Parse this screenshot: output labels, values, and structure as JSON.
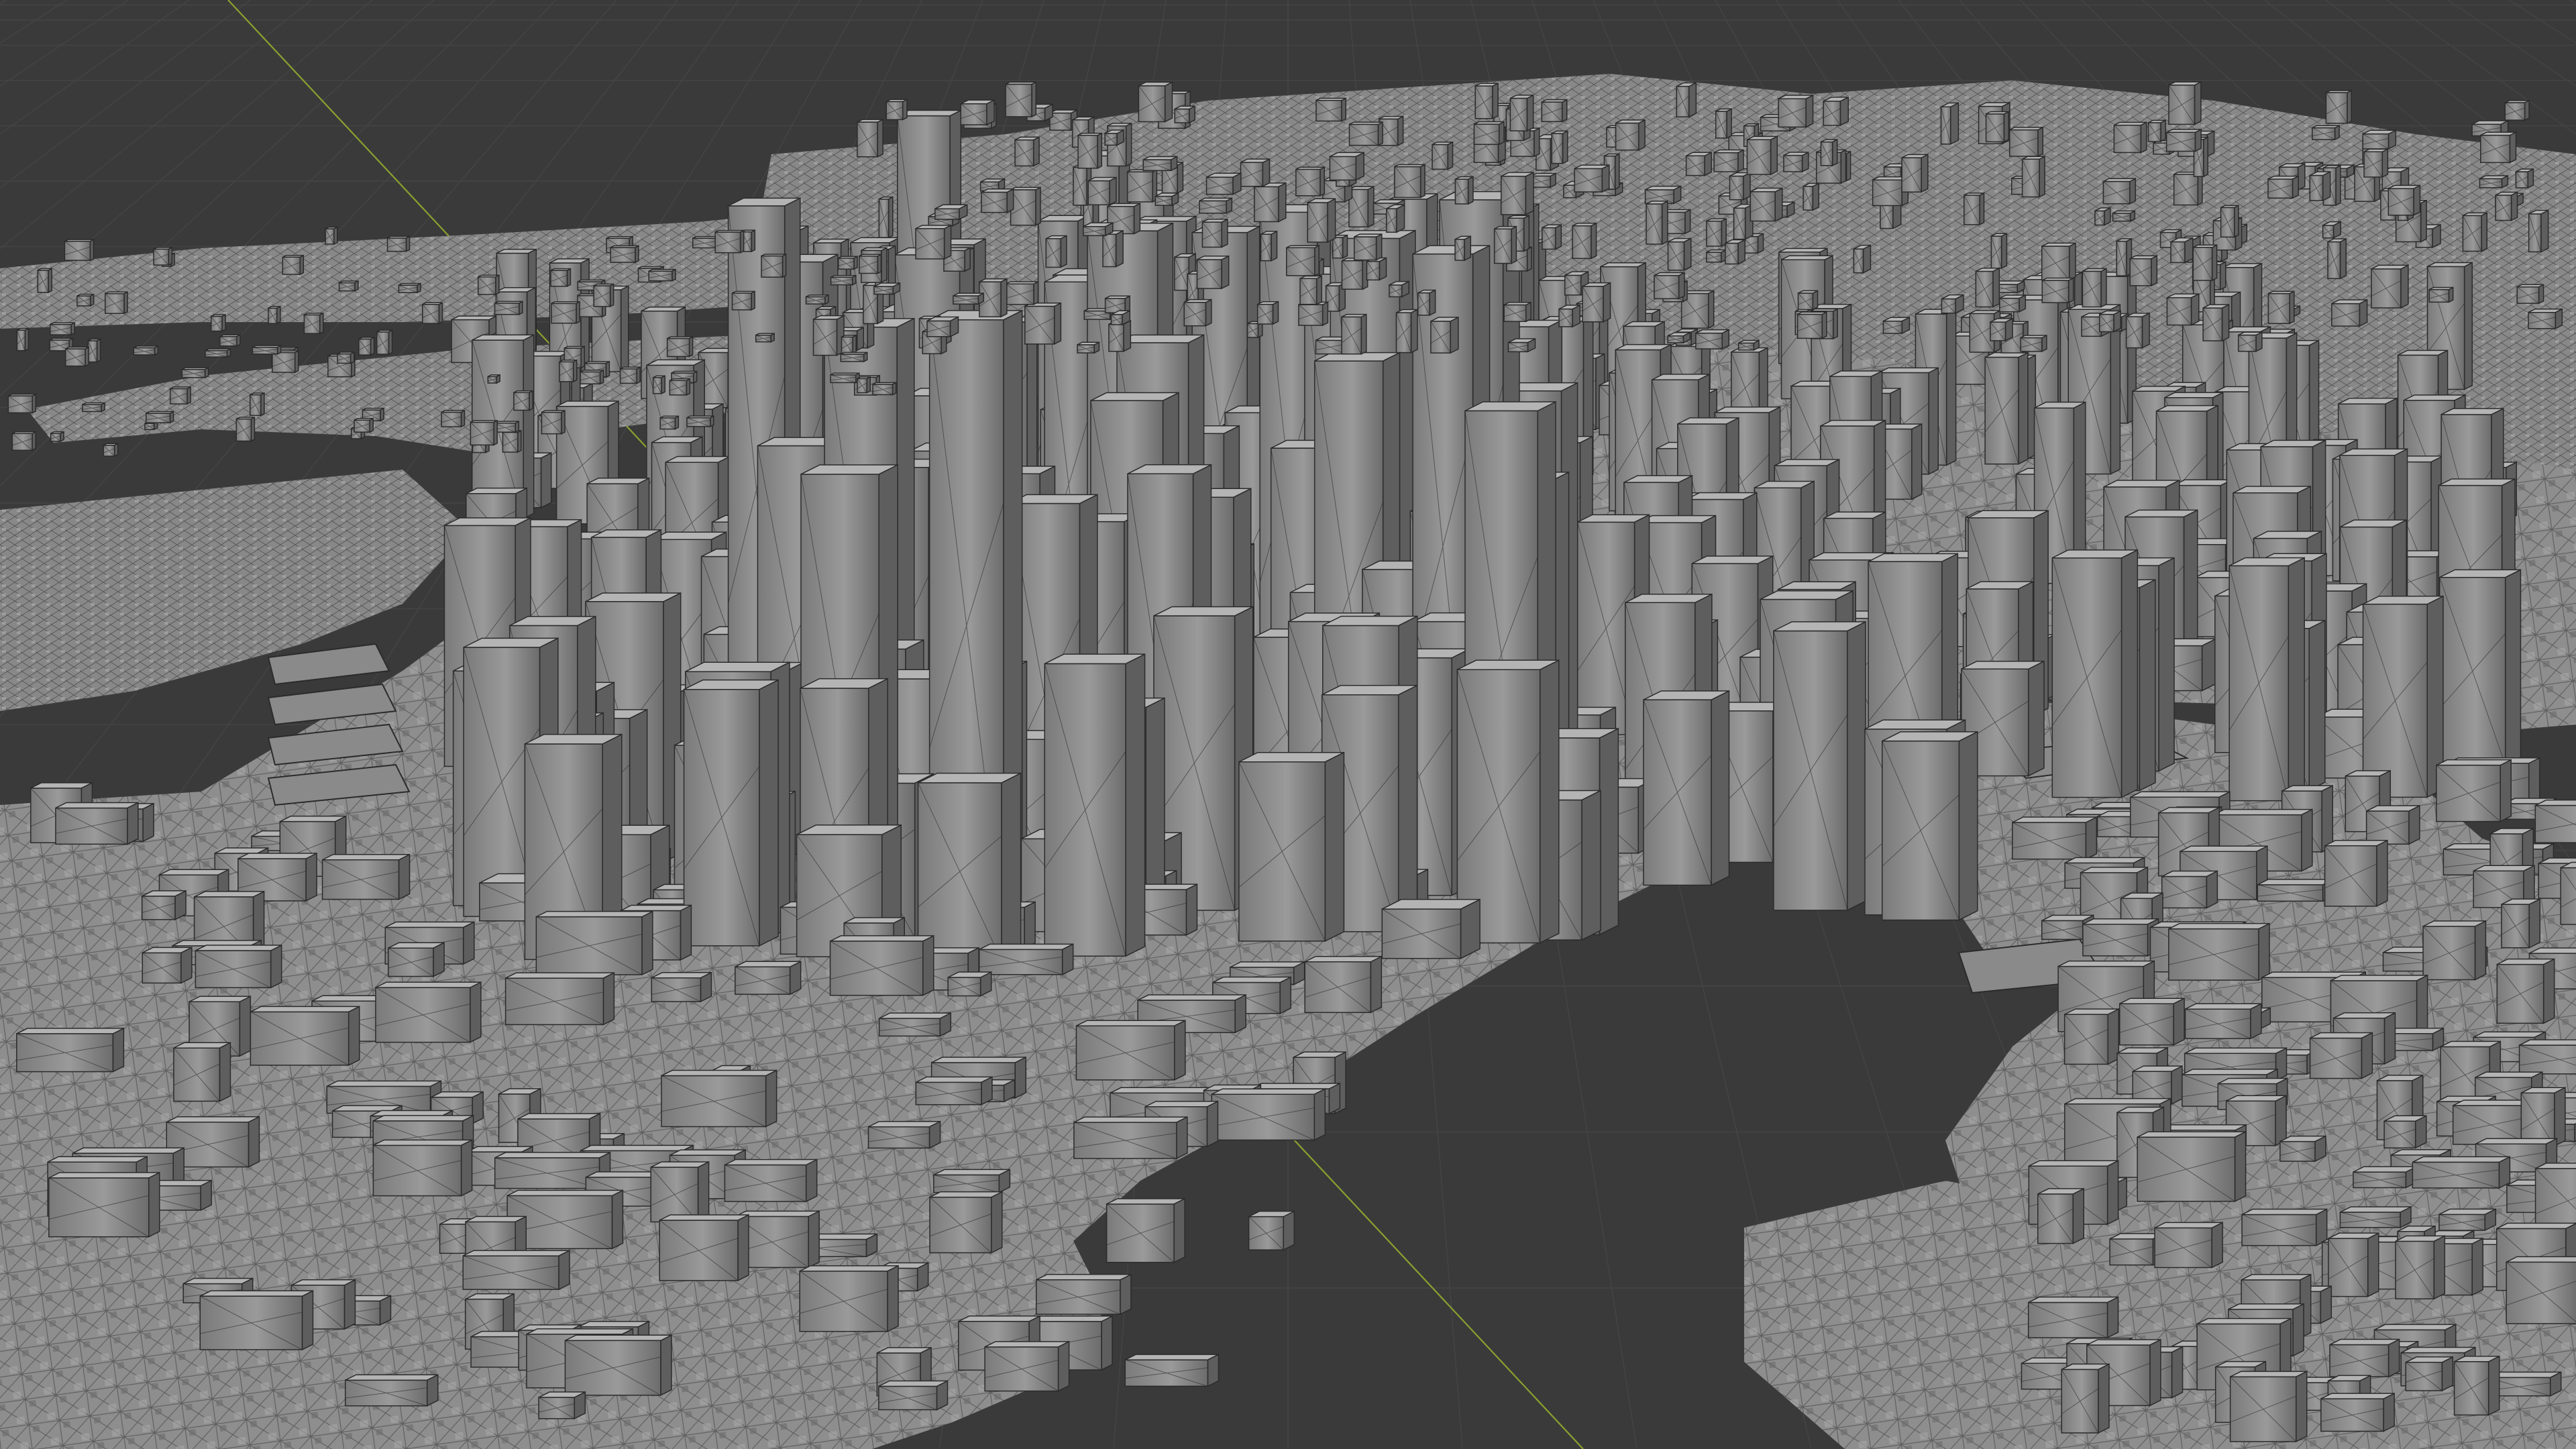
{
  "viewport": {
    "background_color": "#3a3a3a",
    "grid_color": "#444444",
    "y_axis_color": "#8aa12f",
    "mesh_fill_color": "#8c8c8c",
    "mesh_shadow_color": "#5e5e5e",
    "mesh_wire_color": "#2b2b2b",
    "mesh_highlight_color": "#b4b4b4",
    "shading_mode": "solid-wireframe"
  }
}
